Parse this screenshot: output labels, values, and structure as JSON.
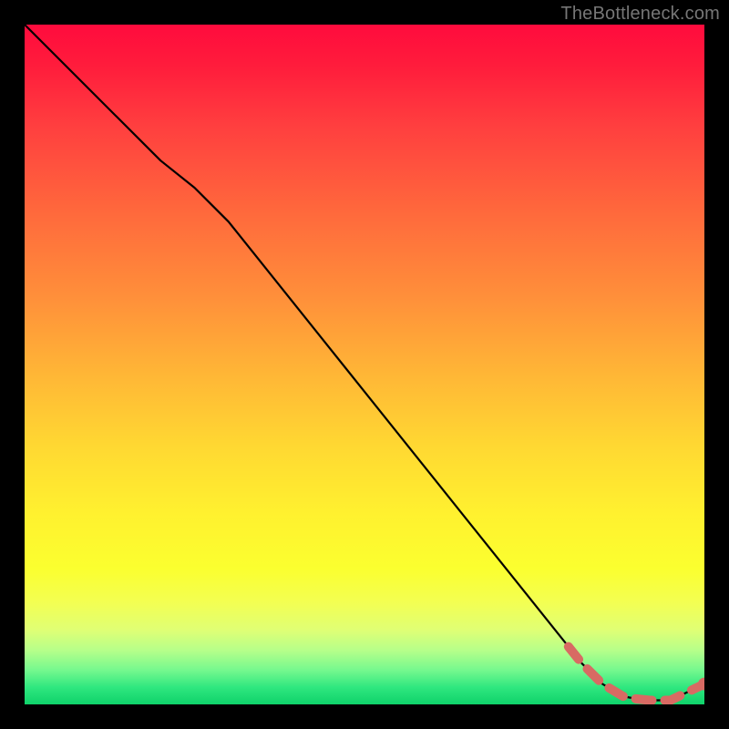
{
  "watermark": "TheBottleneck.com",
  "colors": {
    "background": "#000000",
    "curve": "#000000",
    "marker_stroke": "#d86a63",
    "marker_fill": "#d86a63",
    "watermark": "#767676"
  },
  "chart_data": {
    "type": "line",
    "title": "",
    "xlabel": "",
    "ylabel": "",
    "xlim": [
      0,
      100
    ],
    "ylim": [
      0,
      100
    ],
    "grid": false,
    "legend": false,
    "series": [
      {
        "name": "bottleneck-curve",
        "style": "solid-black",
        "x": [
          0,
          10,
          20,
          25,
          30,
          40,
          50,
          60,
          70,
          80,
          82,
          85,
          88,
          90,
          92,
          95,
          100
        ],
        "y": [
          100,
          90,
          80,
          76,
          71,
          58.5,
          46,
          33.5,
          21,
          8.5,
          6,
          3,
          1.2,
          0.8,
          0.6,
          0.6,
          3
        ]
      },
      {
        "name": "highlighted-range",
        "style": "thick-dashed-marker",
        "x": [
          80,
          82,
          85,
          88,
          90,
          92,
          95,
          100
        ],
        "y": [
          8.5,
          6,
          3,
          1.2,
          0.8,
          0.6,
          0.6,
          3
        ]
      }
    ],
    "annotations": []
  }
}
